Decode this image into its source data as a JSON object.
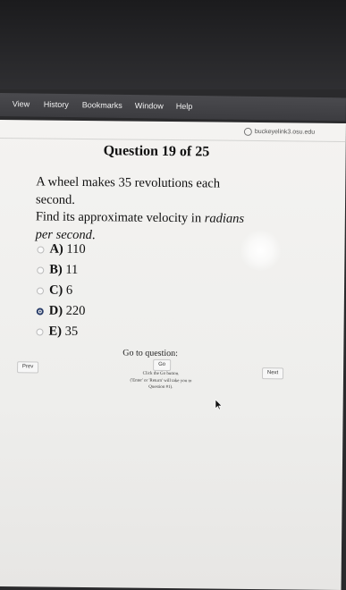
{
  "menu": {
    "items": [
      "View",
      "History",
      "Bookmarks",
      "Window",
      "Help"
    ]
  },
  "browser": {
    "site": "buckeyelink3.osu.edu"
  },
  "quiz": {
    "title": "Question 19 of 25",
    "question": {
      "line1": "A wheel makes 35 revolutions each",
      "line2": "second.",
      "line3_a": "Find its approximate velocity in ",
      "line3_b": "radians",
      "line4": "per second",
      "line4_end": "."
    },
    "choices": [
      {
        "letter": "A)",
        "value": "110",
        "selected": false
      },
      {
        "letter": "B)",
        "value": "11",
        "selected": false
      },
      {
        "letter": "C)",
        "value": "6",
        "selected": false
      },
      {
        "letter": "D)",
        "value": "220",
        "selected": true
      },
      {
        "letter": "E)",
        "value": "35",
        "selected": false
      }
    ],
    "goto_label": "Go to question:",
    "go_button": "Go",
    "hint": {
      "line1": "Click the Go button.",
      "line2": "('Enter' or 'Return' will take you to",
      "line3": "Question #1)."
    },
    "prev_button": "Prev",
    "next_button": "Next"
  }
}
